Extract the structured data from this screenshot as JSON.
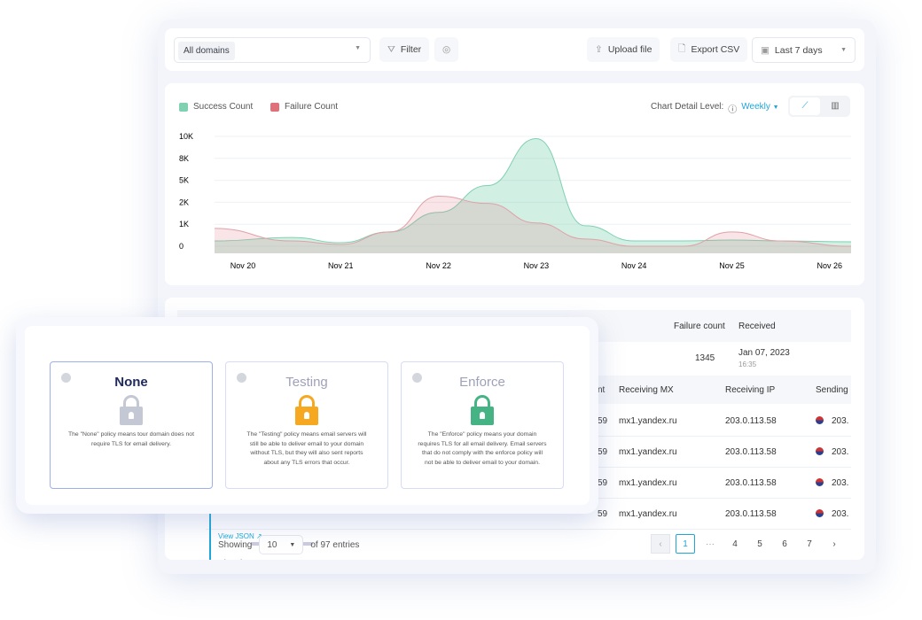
{
  "toolbar": {
    "domain_select": "All domains",
    "filter": "Filter",
    "upload": "Upload file",
    "export": "Export CSV",
    "date_range": "Last 7 days"
  },
  "chart_controls": {
    "detail_label": "Chart Detail Level:",
    "detail_value": "Weekly",
    "accent": "#1fa6d8"
  },
  "chart_data": {
    "type": "area",
    "legend": [
      {
        "name": "Success Count",
        "color": "#7fd1b2"
      },
      {
        "name": "Failure Count",
        "color": "#e0707a"
      }
    ],
    "legend_position": "top-left",
    "y_ticks": [
      "10K",
      "8K",
      "5K",
      "2K",
      "1K",
      "0"
    ],
    "y_tick_values": [
      10000,
      8000,
      5000,
      2000,
      1000,
      0
    ],
    "x_ticks": [
      "Nov 20",
      "Nov 21",
      "Nov 22",
      "Nov 23",
      "Nov 24",
      "Nov 25",
      "Nov 26"
    ],
    "x": [
      "Nov 20 00:00",
      "Nov 20 12:00",
      "Nov 21 00:00",
      "Nov 21 12:00",
      "Nov 22 00:00",
      "Nov 22 12:00",
      "Nov 23 00:00",
      "Nov 23 12:00",
      "Nov 24 00:00",
      "Nov 24 12:00",
      "Nov 25 00:00",
      "Nov 25 12:00",
      "Nov 26 00:00"
    ],
    "series": [
      {
        "name": "Success Count",
        "values": [
          240,
          400,
          160,
          650,
          1540,
          4280,
          9800,
          930,
          240,
          240,
          280,
          240,
          200
        ]
      },
      {
        "name": "Failure Count",
        "values": [
          810,
          240,
          80,
          650,
          2840,
          1950,
          1060,
          330,
          0,
          0,
          650,
          240,
          0
        ]
      }
    ],
    "grid": "horizontal"
  },
  "table": {
    "summary_headers": [
      "Failure count",
      "Received"
    ],
    "summary_row": {
      "failure_count": "1345",
      "date": "Jan 07, 2023",
      "time": "16:35"
    },
    "headers": [
      "nt",
      "Receiving MX",
      "Receiving IP",
      "Sending"
    ],
    "rows": [
      {
        "count": "59",
        "mx": "mx1.yandex.ru",
        "ip": "203.0.113.58",
        "sending": "203."
      },
      {
        "count": "59",
        "mx": "mx1.yandex.ru",
        "ip": "203.0.113.58",
        "sending": "203."
      },
      {
        "count": "59",
        "mx": "mx1.yandex.ru",
        "ip": "203.0.113.58",
        "sending": "203."
      },
      {
        "count": "59",
        "mx": "mx1.yandex.ru",
        "ip": "203.0.113.58",
        "sending": "203."
      }
    ],
    "view_json": "View JSON",
    "showing": "Showing",
    "page_size": "10",
    "entries": "of 97 entries",
    "pages": [
      "1",
      "4",
      "5",
      "6",
      "7"
    ],
    "ellipsis": "···"
  },
  "policies": [
    {
      "title": "None",
      "desc": "The \"None\" policy means tour domain does not require TLS for email delivery.",
      "color": "#c4c7d4"
    },
    {
      "title": "Testing",
      "desc": "The \"Testing\" policy means email servers will still be able to deliver email to your domain without TLS, but they will also sent reports about any TLS errors that occur.",
      "color": "#f6a821"
    },
    {
      "title": "Enforce",
      "desc": "The \"Enforce\" policy means your domain requires TLS for all email delivery. Email servers that do not comply with the enforce policy will not be able to deliver email to your domain.",
      "color": "#45b383"
    }
  ]
}
